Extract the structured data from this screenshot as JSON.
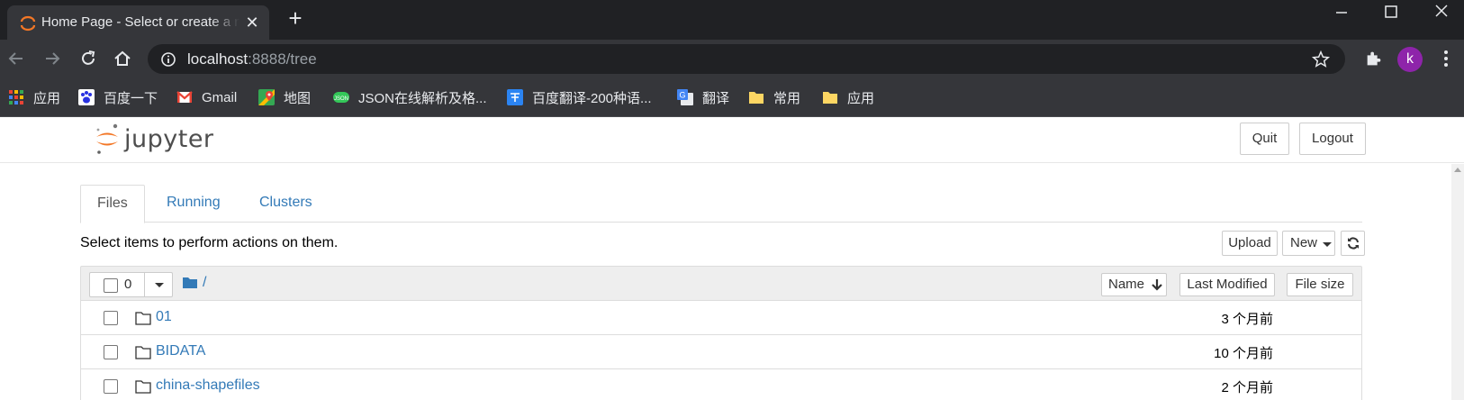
{
  "browser": {
    "tab_title": "Home Page - Select or create a notebook",
    "url_host": "localhost",
    "url_rest": ":8888/tree",
    "profile_initial": "k",
    "bookmarks": [
      {
        "label": "应用",
        "icon": "apps-grid-icon"
      },
      {
        "label": "百度一下",
        "icon": "baidu-paw-icon"
      },
      {
        "label": "Gmail",
        "icon": "gmail-icon"
      },
      {
        "label": "地图",
        "icon": "maps-icon"
      },
      {
        "label": "JSON在线解析及格...",
        "icon": "json-icon"
      },
      {
        "label": "百度翻译-200种语...",
        "icon": "baidu-translate-icon"
      },
      {
        "label": "翻译",
        "icon": "google-translate-icon"
      },
      {
        "label": "常用",
        "icon": "folder-icon"
      },
      {
        "label": "应用",
        "icon": "folder-icon"
      }
    ]
  },
  "header": {
    "logo_text": "jupyter",
    "quit_label": "Quit",
    "logout_label": "Logout"
  },
  "tabs": [
    {
      "label": "Files",
      "active": true
    },
    {
      "label": "Running",
      "active": false
    },
    {
      "label": "Clusters",
      "active": false
    }
  ],
  "files": {
    "instructions": "Select items to perform actions on them.",
    "upload_label": "Upload",
    "new_label": "New",
    "selected_count": "0",
    "path": "/",
    "sort_name_label": "Name",
    "sort_modified_label": "Last Modified",
    "sort_size_label": "File size",
    "items": [
      {
        "name": "01",
        "modified": "3 个月前"
      },
      {
        "name": "BIDATA",
        "modified": "10 个月前"
      },
      {
        "name": "china-shapefiles",
        "modified": "2 个月前"
      }
    ]
  },
  "colors": {
    "link": "#337ab7",
    "jupyter_orange": "#f37726",
    "chrome_dark": "#202124",
    "chrome_toolbar": "#35363a",
    "avatar": "#8e24aa"
  }
}
